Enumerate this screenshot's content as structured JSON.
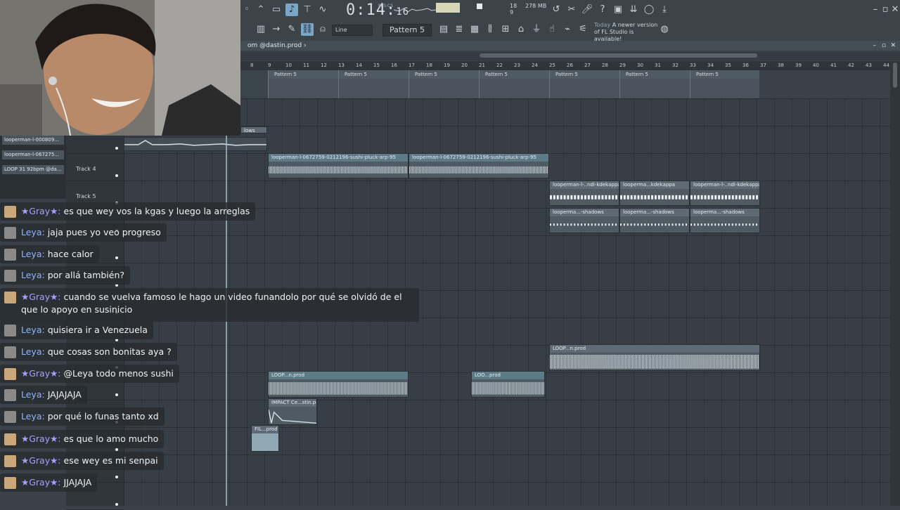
{
  "toolbar": {
    "time_main": "0:14:",
    "time_frac": "16",
    "time_unit": "M:S:CS",
    "cpu_value": "278 MB",
    "cpu_num": "18",
    "poly_num": "9",
    "snap_label": "Line",
    "pattern_label": "Pattern 5",
    "news_today": "Today",
    "news_text": "A newer version of FL Studio is available!"
  },
  "playlist": {
    "title": "om @dastin.prod ›",
    "ruler": [
      "8",
      "9",
      "10",
      "11",
      "12",
      "13",
      "14",
      "15",
      "16",
      "17",
      "18",
      "19",
      "20",
      "21",
      "22",
      "23",
      "24",
      "25",
      "26",
      "27",
      "28",
      "29",
      "30",
      "31",
      "32",
      "33",
      "34",
      "35",
      "36",
      "37",
      "38",
      "39",
      "40",
      "41",
      "42",
      "43",
      "44"
    ],
    "pattern_clip_label": "Pattern 5",
    "tracks": [
      {
        "name": ""
      },
      {
        "name": ""
      },
      {
        "name": "Track 4"
      },
      {
        "name": "Track 5"
      },
      {
        "name": ""
      },
      {
        "name": ""
      },
      {
        "name": ""
      },
      {
        "name": ""
      },
      {
        "name": ""
      },
      {
        "name": ""
      },
      {
        "name": ""
      },
      {
        "name": ""
      },
      {
        "name": ""
      },
      {
        "name": ""
      },
      {
        "name": ""
      }
    ],
    "clip_list": [
      "looperman-l-000809...",
      "looperman-l-067275...",
      "LOOP 31 92bpm @da..."
    ],
    "clips": {
      "small_top": "lows",
      "sushi_a": "looperman-l-0672759-0212196-sushi-pluck-arp-95",
      "sushi_b": "looperman-l-0672759-0212196-sushi-pluck-arp-95",
      "kdekappa_a": "looperman-l-..ndi-kdekappa",
      "kdekappa_b": "looperma...kdekappa",
      "kdekappa_c": "looperman-l-..ndi-kdekappa",
      "shadows_a": "looperma...-shadows",
      "shadows_b": "looperma...-shadows",
      "shadows_c": "looperma...-shadows",
      "loop_big": "LOOP...n.prod",
      "loop_mid": "LOOP...n.prod",
      "loop_mid2": "LOO...prod",
      "impact": "IMPACT Ce...stin.prod",
      "fil": "FIL...prod"
    }
  },
  "chat": [
    {
      "user": "★Gray★:",
      "msg": "es que wey vos la kgas y luego la arreglas",
      "cls": "gray"
    },
    {
      "user": "Leya:",
      "msg": "jaja pues yo veo progreso",
      "cls": "leya"
    },
    {
      "user": "Leya:",
      "msg": "hace calor",
      "cls": "leya"
    },
    {
      "user": "Leya:",
      "msg": "por allá también?",
      "cls": "leya"
    },
    {
      "user": "★Gray★:",
      "msg": "cuando se vuelva famoso le hago un video funandolo por qué se olvidó de el que lo apoyo en susinicio",
      "cls": "gray"
    },
    {
      "user": "Leya:",
      "msg": "quisiera ir a Venezuela",
      "cls": "leya"
    },
    {
      "user": "Leya:",
      "msg": "que cosas son bonitas aya ?",
      "cls": "leya"
    },
    {
      "user": "★Gray★:",
      "msg": "@Leya todo menos sushi",
      "cls": "gray"
    },
    {
      "user": "Leya:",
      "msg": "JAJAJAJA",
      "cls": "leya"
    },
    {
      "user": "Leya:",
      "msg": "por qué lo funas tanto xd",
      "cls": "leya"
    },
    {
      "user": "★Gray★:",
      "msg": "es que lo amo mucho",
      "cls": "gray"
    },
    {
      "user": "★Gray★:",
      "msg": "ese wey es mi senpai",
      "cls": "gray"
    },
    {
      "user": "★Gray★:",
      "msg": "JJAJAJA",
      "cls": "gray"
    }
  ],
  "colors": {
    "leya": "#8fb4ff",
    "gray": "#a7a0ff",
    "playhead": "#a9c9d6",
    "accent": "#7aa6c8"
  }
}
